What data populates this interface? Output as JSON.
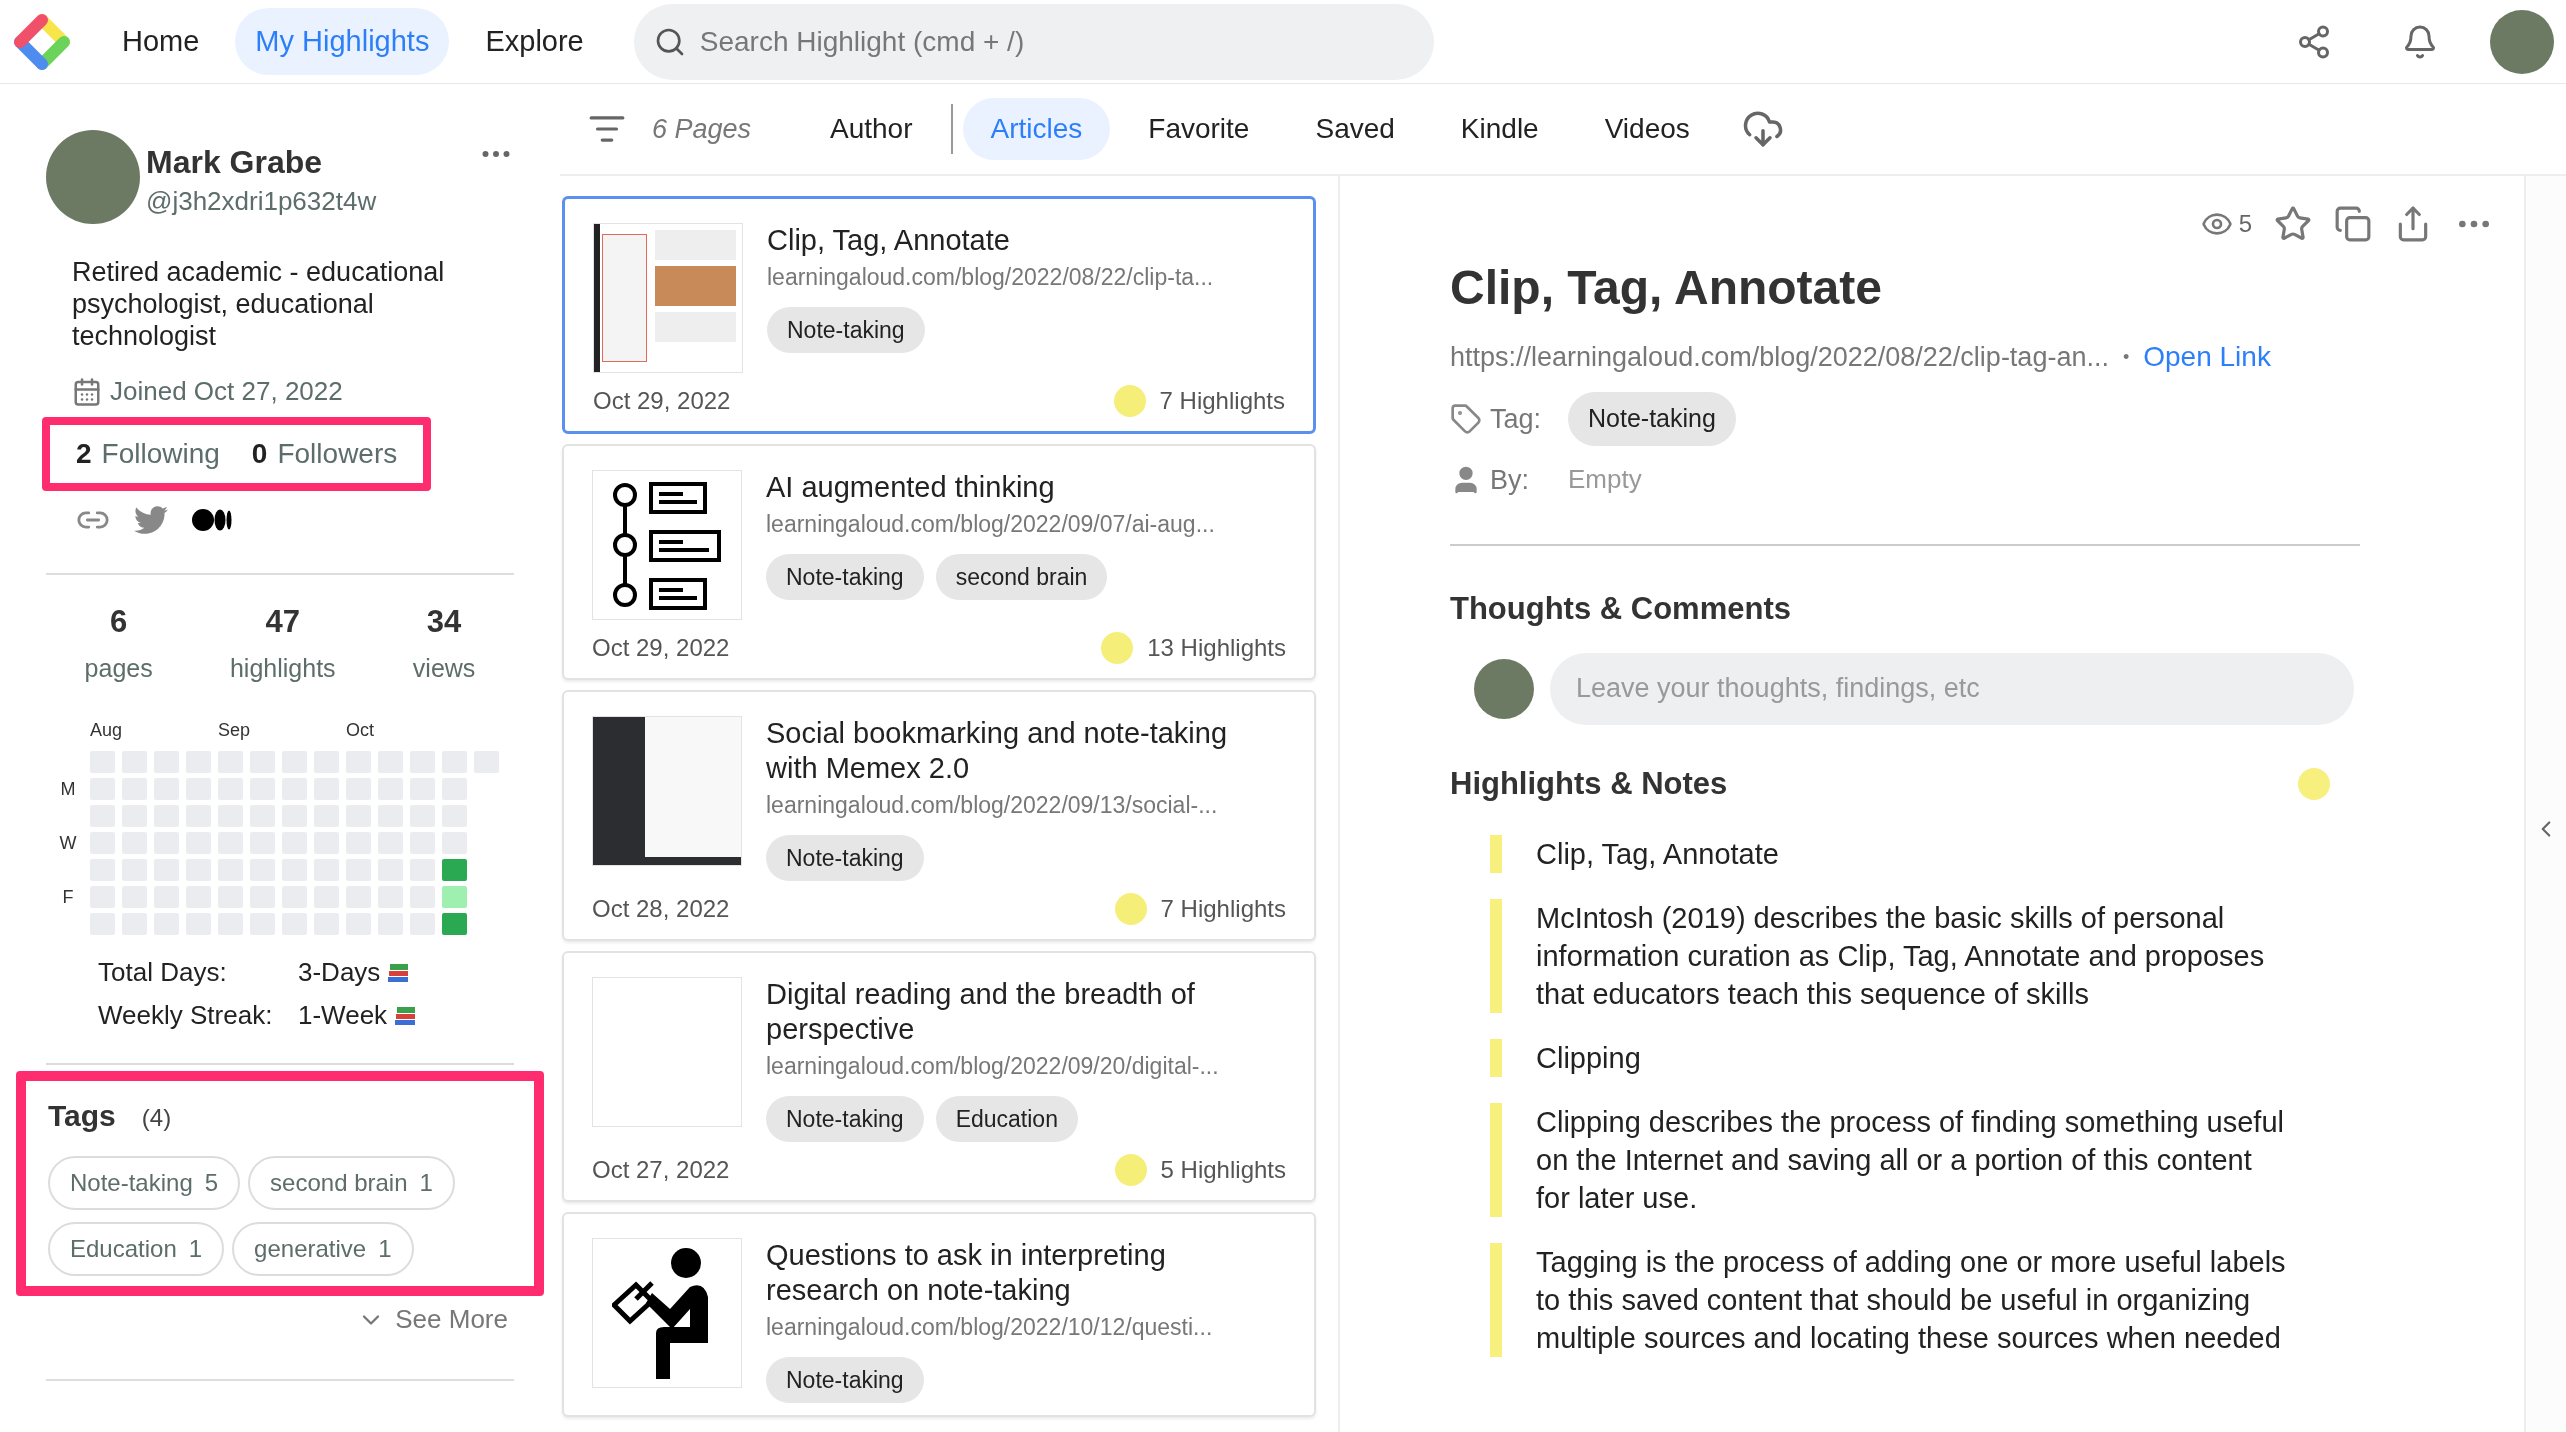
{
  "nav": {
    "items": [
      {
        "label": "Home",
        "selected": false
      },
      {
        "label": "My Highlights",
        "selected": true
      },
      {
        "label": "Explore",
        "selected": false
      }
    ],
    "search": {
      "placeholder": "Search Highlight (cmd + /)"
    }
  },
  "profile": {
    "name": "Mark Grabe",
    "handle": "@j3h2xdri1p632t4w",
    "bio": "Retired academic - educational psychologist, educational technologist",
    "joined": "Joined Oct 27, 2022",
    "follow": {
      "annotated": true,
      "following_count": "2",
      "following_label": "Following",
      "followers_count": "0",
      "followers_label": "Followers"
    },
    "stats": [
      {
        "value": "6",
        "label": "pages"
      },
      {
        "value": "47",
        "label": "highlights"
      },
      {
        "value": "34",
        "label": "views"
      }
    ],
    "heatmap": {
      "months": [
        "Aug",
        "Sep",
        "Oct"
      ],
      "day_labels": [
        "M",
        "W",
        "F"
      ],
      "weeks": [
        [
          {
            "color": "#ebecef"
          },
          {
            "color": "#ebecef"
          },
          {
            "color": "#ebecef"
          },
          {
            "color": "#ebecef"
          },
          {
            "color": "#ebecef"
          },
          {
            "color": "#ebecef"
          },
          {
            "color": "#ebecef"
          }
        ],
        [
          {
            "color": "#ebecef"
          },
          {
            "color": "#ebecef"
          },
          {
            "color": "#ebecef"
          },
          {
            "color": "#ebecef"
          },
          {
            "color": "#ebecef"
          },
          {
            "color": "#ebecef"
          },
          {
            "color": "#ebecef"
          }
        ],
        [
          {
            "color": "#ebecef"
          },
          {
            "color": "#ebecef"
          },
          {
            "color": "#ebecef"
          },
          {
            "color": "#ebecef"
          },
          {
            "color": "#ebecef"
          },
          {
            "color": "#ebecef"
          },
          {
            "color": "#ebecef"
          }
        ],
        [
          {
            "color": "#ebecef"
          },
          {
            "color": "#ebecef"
          },
          {
            "color": "#ebecef"
          },
          {
            "color": "#ebecef"
          },
          {
            "color": "#ebecef"
          },
          {
            "color": "#ebecef"
          },
          {
            "color": "#ebecef"
          }
        ],
        [
          {
            "color": "#ebecef"
          },
          {
            "color": "#ebecef"
          },
          {
            "color": "#ebecef"
          },
          {
            "color": "#ebecef"
          },
          {
            "color": "#ebecef"
          },
          {
            "color": "#ebecef"
          },
          {
            "color": "#ebecef"
          }
        ],
        [
          {
            "color": "#ebecef"
          },
          {
            "color": "#ebecef"
          },
          {
            "color": "#ebecef"
          },
          {
            "color": "#ebecef"
          },
          {
            "color": "#ebecef"
          },
          {
            "color": "#ebecef"
          },
          {
            "color": "#ebecef"
          }
        ],
        [
          {
            "color": "#ebecef"
          },
          {
            "color": "#ebecef"
          },
          {
            "color": "#ebecef"
          },
          {
            "color": "#ebecef"
          },
          {
            "color": "#ebecef"
          },
          {
            "color": "#ebecef"
          },
          {
            "color": "#ebecef"
          }
        ],
        [
          {
            "color": "#ebecef"
          },
          {
            "color": "#ebecef"
          },
          {
            "color": "#ebecef"
          },
          {
            "color": "#ebecef"
          },
          {
            "color": "#ebecef"
          },
          {
            "color": "#ebecef"
          },
          {
            "color": "#ebecef"
          }
        ],
        [
          {
            "color": "#ebecef"
          },
          {
            "color": "#ebecef"
          },
          {
            "color": "#ebecef"
          },
          {
            "color": "#ebecef"
          },
          {
            "color": "#ebecef"
          },
          {
            "color": "#ebecef"
          },
          {
            "color": "#ebecef"
          }
        ],
        [
          {
            "color": "#ebecef"
          },
          {
            "color": "#ebecef"
          },
          {
            "color": "#ebecef"
          },
          {
            "color": "#ebecef"
          },
          {
            "color": "#ebecef"
          },
          {
            "color": "#ebecef"
          },
          {
            "color": "#ebecef"
          }
        ],
        [
          {
            "color": "#ebecef"
          },
          {
            "color": "#ebecef"
          },
          {
            "color": "#ebecef"
          },
          {
            "color": "#ebecef"
          },
          {
            "color": "#ebecef"
          },
          {
            "color": "#ebecef"
          },
          {
            "color": "#ebecef"
          }
        ],
        [
          {
            "color": "#ebecef"
          },
          {
            "color": "#ebecef"
          },
          {
            "color": "#ebecef"
          },
          {
            "color": "#ebecef"
          },
          {
            "color": "#2aa952"
          },
          {
            "color": "#9fefb0"
          },
          {
            "color": "#2aa952"
          }
        ],
        [
          {
            "color": "#ebecef"
          }
        ]
      ]
    },
    "streaks": [
      {
        "label": "Total Days:",
        "value": "3-Days"
      },
      {
        "label": "Weekly Streak:",
        "value": "1-Week"
      }
    ],
    "tags": {
      "annotated": true,
      "title": "Tags",
      "count": "(4)",
      "items": [
        {
          "name": "Note-taking",
          "count": "5"
        },
        {
          "name": "second brain",
          "count": "1"
        },
        {
          "name": "Education",
          "count": "1"
        },
        {
          "name": "generative",
          "count": "1"
        }
      ],
      "see_more": "See More"
    }
  },
  "list_header": {
    "pages": "6 Pages",
    "tabs": [
      {
        "label": "Author",
        "selected": false
      },
      {
        "label": "Articles",
        "selected": true
      },
      {
        "label": "Favorite",
        "selected": false
      },
      {
        "label": "Saved",
        "selected": false
      },
      {
        "label": "Kindle",
        "selected": false
      },
      {
        "label": "Videos",
        "selected": false
      }
    ]
  },
  "cards": [
    {
      "selected": true,
      "kind": "page-light",
      "title": "Clip, Tag, Annotate",
      "url": "learningaloud.com/blog/2022/08/22/clip-ta...",
      "tags": [
        "Note-taking"
      ],
      "date": "Oct 29, 2022",
      "highlights": "7 Highlights"
    },
    {
      "selected": false,
      "kind": "timeline",
      "title": "AI augmented thinking",
      "url": "learningaloud.com/blog/2022/09/07/ai-aug...",
      "tags": [
        "Note-taking",
        "second brain"
      ],
      "date": "Oct 29, 2022",
      "highlights": "13 Highlights"
    },
    {
      "selected": false,
      "kind": "page-dark",
      "title": "Social bookmarking and note-taking with Memex 2.0",
      "url": "learningaloud.com/blog/2022/09/13/social-...",
      "tags": [
        "Note-taking"
      ],
      "date": "Oct 28, 2022",
      "highlights": "7 Highlights"
    },
    {
      "selected": false,
      "kind": "blank",
      "title": "Digital reading and the breadth of perspective",
      "url": "learningaloud.com/blog/2022/09/20/digital-...",
      "tags": [
        "Note-taking",
        "Education"
      ],
      "date": "Oct 27, 2022",
      "highlights": "5 Highlights"
    },
    {
      "selected": false,
      "kind": "reader",
      "title": "Questions to ask in interpreting research on note-taking",
      "url": "learningaloud.com/blog/2022/10/12/questi...",
      "tags": [
        "Note-taking"
      ]
    }
  ],
  "detail": {
    "views": "5",
    "title": "Clip, Tag, Annotate",
    "url": "https://learningaloud.com/blog/2022/08/22/clip-tag-an...",
    "separator": "•",
    "open_link": "Open Link",
    "tag_label": "Tag:",
    "tag": "Note-taking",
    "by_label": "By:",
    "by_value": "Empty",
    "comments": {
      "title": "Thoughts & Comments",
      "placeholder": "Leave your thoughts, findings, etc"
    },
    "highlights": {
      "title": "Highlights & Notes",
      "color": "#f7f07f",
      "items": [
        "Clip, Tag, Annotate",
        "McIntosh (2019) describes the basic skills of personal information curation as Clip, Tag, Annotate and proposes that educators teach this sequence of skills",
        "Clipping",
        "Clipping describes the process of finding something useful on the Internet and saving all or a portion of this content for later use.",
        "Tagging is the process of adding one or more useful labels to this saved content that should be useful in organizing multiple sources and locating these sources when needed"
      ]
    }
  }
}
